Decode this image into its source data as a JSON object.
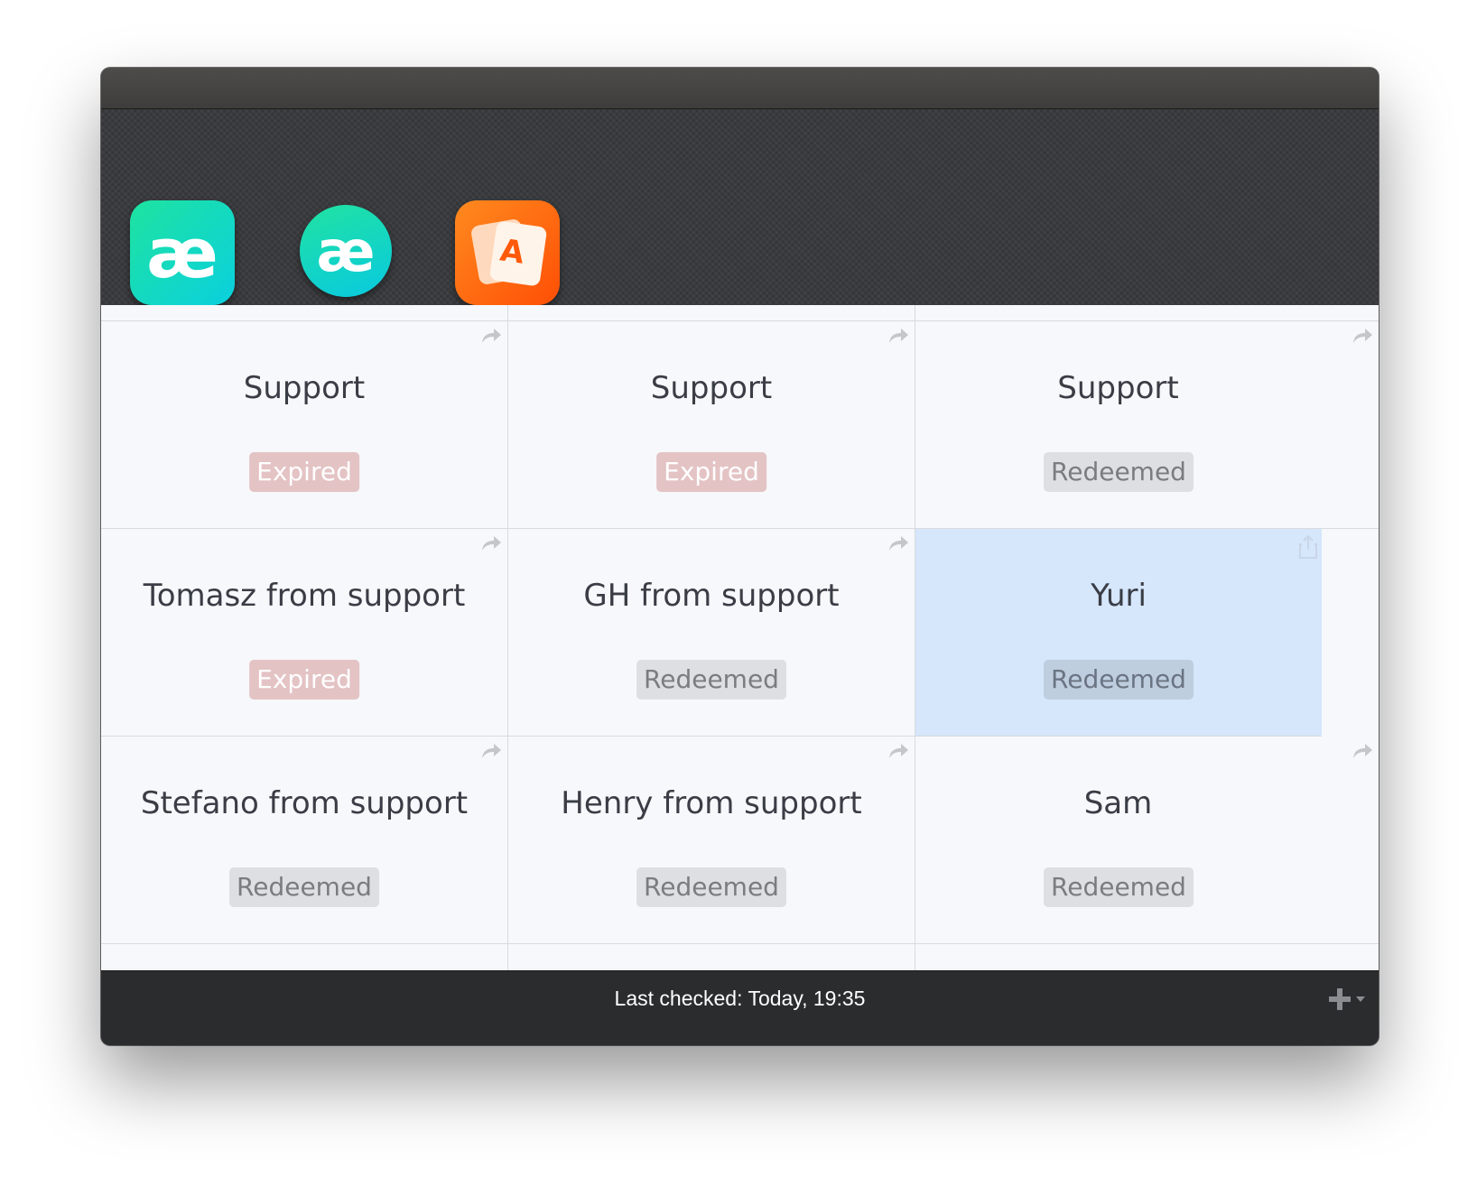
{
  "app_switcher": {
    "apps": [
      {
        "icon": "ae-app-icon",
        "glyph": "æ",
        "color": "#1ee3a0"
      },
      {
        "icon": "ae-circle-app-icon",
        "glyph": "æ",
        "color": "#08c9e0"
      },
      {
        "icon": "cards-app-icon",
        "glyph": "A",
        "color": "#ff6a10"
      }
    ],
    "selected_index": 1
  },
  "codes": [
    {
      "title": "Support",
      "status": "Expired",
      "action_icon": "forward-arrow-icon"
    },
    {
      "title": "Support",
      "status": "Expired",
      "action_icon": "forward-arrow-icon"
    },
    {
      "title": "Support",
      "status": "Redeemed",
      "action_icon": "forward-arrow-icon"
    },
    {
      "title": "Tomasz from support",
      "status": "Expired",
      "action_icon": "forward-arrow-icon"
    },
    {
      "title": "GH from support",
      "status": "Redeemed",
      "action_icon": "forward-arrow-icon"
    },
    {
      "title": "Yuri",
      "status": "Redeemed",
      "action_icon": "share-box-icon",
      "selected": true
    },
    {
      "title": "Stefano from support",
      "status": "Redeemed",
      "action_icon": "forward-arrow-icon"
    },
    {
      "title": "Henry from support",
      "status": "Redeemed",
      "action_icon": "forward-arrow-icon"
    },
    {
      "title": "Sam",
      "status": "Redeemed",
      "action_icon": "forward-arrow-icon"
    }
  ],
  "footer": {
    "status_text": "Last checked: Today, 19:35",
    "add_icon": "plus-dropdown-icon"
  },
  "colors": {
    "expired_badge": "#e4c3c4",
    "redeemed_badge": "#dddfe3",
    "selected_cell": "#d6e6fb"
  }
}
